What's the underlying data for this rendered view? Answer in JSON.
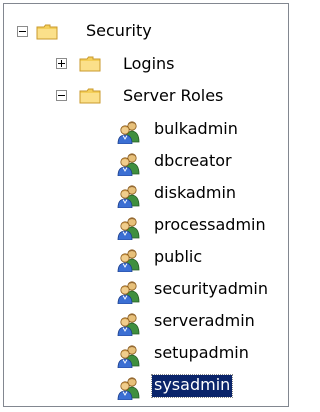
{
  "tree": {
    "root": {
      "label": "Security",
      "expanded": true
    },
    "logins": {
      "label": "Logins",
      "expanded": false
    },
    "server_roles": {
      "label": "Server Roles",
      "expanded": true
    },
    "roles": [
      {
        "label": "bulkadmin"
      },
      {
        "label": "dbcreator"
      },
      {
        "label": "diskadmin"
      },
      {
        "label": "processadmin"
      },
      {
        "label": "public"
      },
      {
        "label": "securityadmin"
      },
      {
        "label": "serveradmin"
      },
      {
        "label": "setupadmin"
      },
      {
        "label": "sysadmin",
        "selected": true
      }
    ]
  },
  "colors": {
    "selection": "#0a246a",
    "folder": "#f4cf5a",
    "border": "#828790"
  },
  "icons": {
    "folder": "folder-icon",
    "role": "server-role-icon",
    "expand": "plus-icon",
    "collapse": "minus-icon"
  }
}
